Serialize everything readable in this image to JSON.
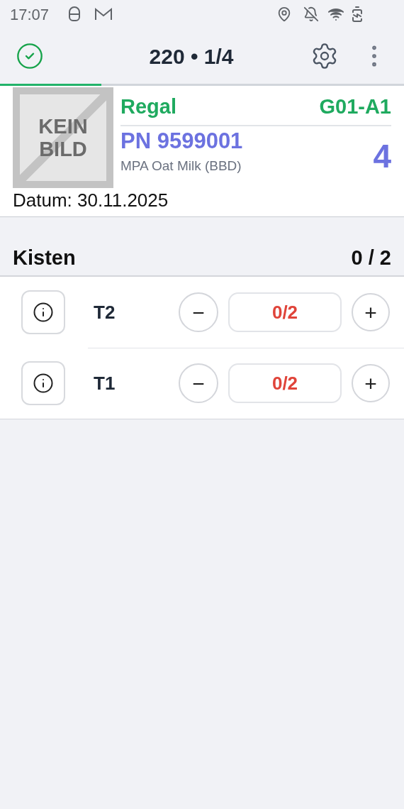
{
  "status_bar": {
    "time": "17:07"
  },
  "header": {
    "title": "220 • 1/4",
    "done": true,
    "progress": {
      "level": 0.25
    }
  },
  "item": {
    "image_placeholder": [
      "KEIN",
      "BILD"
    ],
    "location_label": "Regal",
    "location": "G01-A1",
    "part_number": "PN 9599001",
    "name": "MPA Oat Milk (BBD)",
    "quantity": "4",
    "date": "Datum: 30.11.2025"
  },
  "boxes": {
    "title": "Kisten",
    "count": "0 / 2",
    "rows": [
      {
        "label": "T2",
        "value": "0/2",
        "minus": "−",
        "plus": "+"
      },
      {
        "label": "T1",
        "value": "0/2",
        "minus": "−",
        "plus": "+"
      }
    ]
  }
}
